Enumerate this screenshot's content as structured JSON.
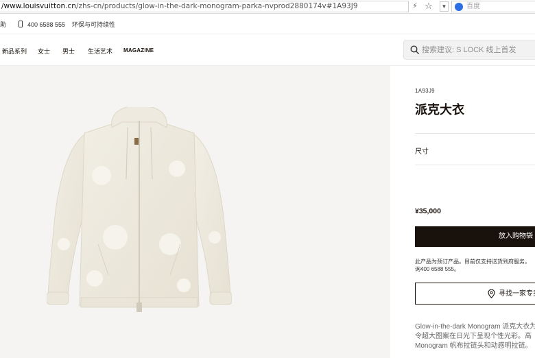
{
  "browser": {
    "url_domain": "/www.louisvuitton.cn",
    "url_path": "/zhs-cn/products/glow-in-the-dark-monogram-parka-nvprod2880174v#1A93J9",
    "search_engine_label": "百度"
  },
  "utility_bar": {
    "help_fragment": "助",
    "phone": "400 6588 555",
    "sustainability": "环保与可持续性"
  },
  "nav": {
    "items": [
      "新品系列",
      "女士",
      "男士",
      "生活艺术",
      "MAGAZINE"
    ],
    "search_placeholder": "搜索建议: S LOCK 线上首发"
  },
  "product": {
    "sku": "1A93J9",
    "title": "派克大衣",
    "size_label": "尺寸",
    "price": "¥35,000",
    "add_to_cart": "放入购物袋",
    "preorder_note_line1": "此产品为预订产品。目前仅支持送货到府服务。",
    "preorder_note_line2": "询400 6588 555。",
    "find_store": "寻找一家专卖",
    "desc_line1": "Glow-in-the-dark Monogram 派克大衣为品",
    "desc_line2": "令超大图案在日光下呈现个性光彩。高",
    "desc_line3": "Monogram 帆布拉链头和动感明拉链。"
  },
  "colors": {
    "brand_dark": "#19110b",
    "image_bg": "#f5f4f2",
    "jacket": "#ece8dc"
  }
}
